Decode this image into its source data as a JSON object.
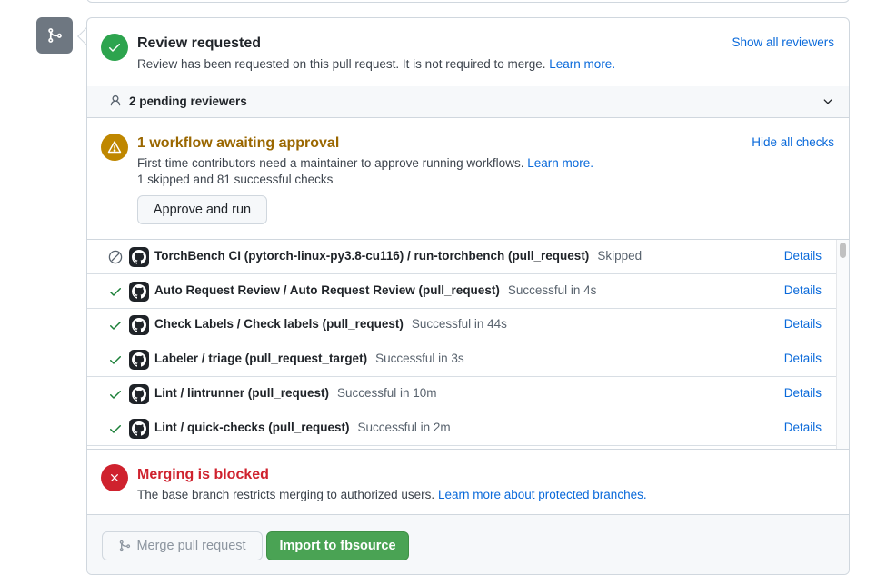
{
  "review": {
    "title": "Review requested",
    "description": "Review has been requested on this pull request. It is not required to merge.",
    "learn_more": "Learn more.",
    "show_all_reviewers": "Show all reviewers",
    "pending_reviewers": "2 pending reviewers"
  },
  "workflow": {
    "title": "1 workflow awaiting approval",
    "description": "First-time contributors need a maintainer to approve running workflows.",
    "learn_more": "Learn more.",
    "summary": "1 skipped and 81 successful checks",
    "hide_all_checks": "Hide all checks",
    "approve_button": "Approve and run"
  },
  "checks": [
    {
      "name": "TorchBench CI (pytorch-linux-py3.8-cu116) / run-torchbench (pull_request)",
      "result": "Skipped",
      "status": "skipped",
      "details": "Details"
    },
    {
      "name": "Auto Request Review / Auto Request Review (pull_request)",
      "result": "Successful in 4s",
      "status": "success",
      "details": "Details"
    },
    {
      "name": "Check Labels / Check labels (pull_request)",
      "result": "Successful in 44s",
      "status": "success",
      "details": "Details"
    },
    {
      "name": "Labeler / triage (pull_request_target)",
      "result": "Successful in 3s",
      "status": "success",
      "details": "Details"
    },
    {
      "name": "Lint / lintrunner (pull_request)",
      "result": "Successful in 10m",
      "status": "success",
      "details": "Details"
    },
    {
      "name": "Lint / quick-checks (pull_request)",
      "result": "Successful in 2m",
      "status": "success",
      "details": "Details"
    }
  ],
  "merge": {
    "title": "Merging is blocked",
    "description": "The base branch restricts merging to authorized users.",
    "learn_more": "Learn more about protected branches.",
    "merge_button": "Merge pull request",
    "import_button": "Import to fbsource"
  },
  "colors": {
    "success": "#2da44e",
    "warning": "#bf8700",
    "danger": "#cf222e",
    "link": "#0969da",
    "primary_button": "#4aa354"
  },
  "icons": {
    "tile": "git-merge-icon",
    "review": "check-circle-icon",
    "reviewers": "person-icon",
    "expand": "chevron-down-icon",
    "workflow": "alert-icon",
    "check_success": "check-icon",
    "check_skipped": "skip-icon",
    "check_avatar": "github-icon",
    "merge": "x-circle-icon",
    "merge_button": "git-merge-icon"
  }
}
